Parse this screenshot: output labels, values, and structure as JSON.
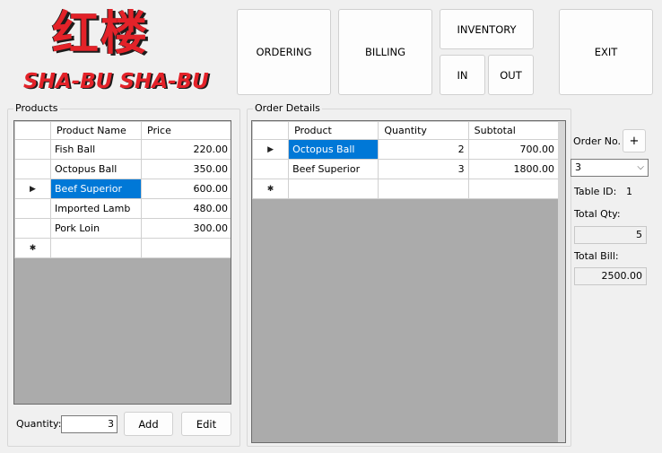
{
  "logo": {
    "title_cn": "红楼",
    "title_en": "SHA-BU SHA-BU"
  },
  "nav": {
    "ordering": "ORDERING",
    "billing": "BILLING",
    "inventory": "INVENTORY",
    "in": "IN",
    "out": "OUT",
    "exit": "EXIT"
  },
  "products": {
    "group_title": "Products",
    "columns": [
      "Product Name",
      "Price"
    ],
    "rows": [
      {
        "name": "Fish Ball",
        "price": "220.00"
      },
      {
        "name": "Octopus Ball",
        "price": "350.00"
      },
      {
        "name": "Beef Superior",
        "price": "600.00"
      },
      {
        "name": "Imported Lamb",
        "price": "480.00"
      },
      {
        "name": "Pork Loin",
        "price": "300.00"
      }
    ],
    "selected_index": 2,
    "quantity_label": "Quantity:",
    "quantity_value": "3",
    "add_label": "Add",
    "edit_label": "Edit"
  },
  "order_details": {
    "group_title": "Order Details",
    "columns": [
      "Product",
      "Quantity",
      "Subtotal"
    ],
    "rows": [
      {
        "product": "Octopus Ball",
        "quantity": "2",
        "subtotal": "700.00"
      },
      {
        "product": "Beef Superior",
        "quantity": "3",
        "subtotal": "1800.00"
      }
    ],
    "selected_index": 0
  },
  "order_panel": {
    "order_no_label": "Order No.",
    "add_order_label": "+",
    "order_no_value": "3",
    "table_id_label": "Table ID:",
    "table_id_value": "1",
    "total_qty_label": "Total Qty:",
    "total_qty_value": "5",
    "total_bill_label": "Total Bill:",
    "total_bill_value": "2500.00"
  },
  "glyphs": {
    "current_row": "▶",
    "new_row": "✱",
    "dropdown": "⌵"
  },
  "colors": {
    "logo_red": "#e32229",
    "selection_blue": "#0078d7",
    "grid_background": "#ababab"
  }
}
